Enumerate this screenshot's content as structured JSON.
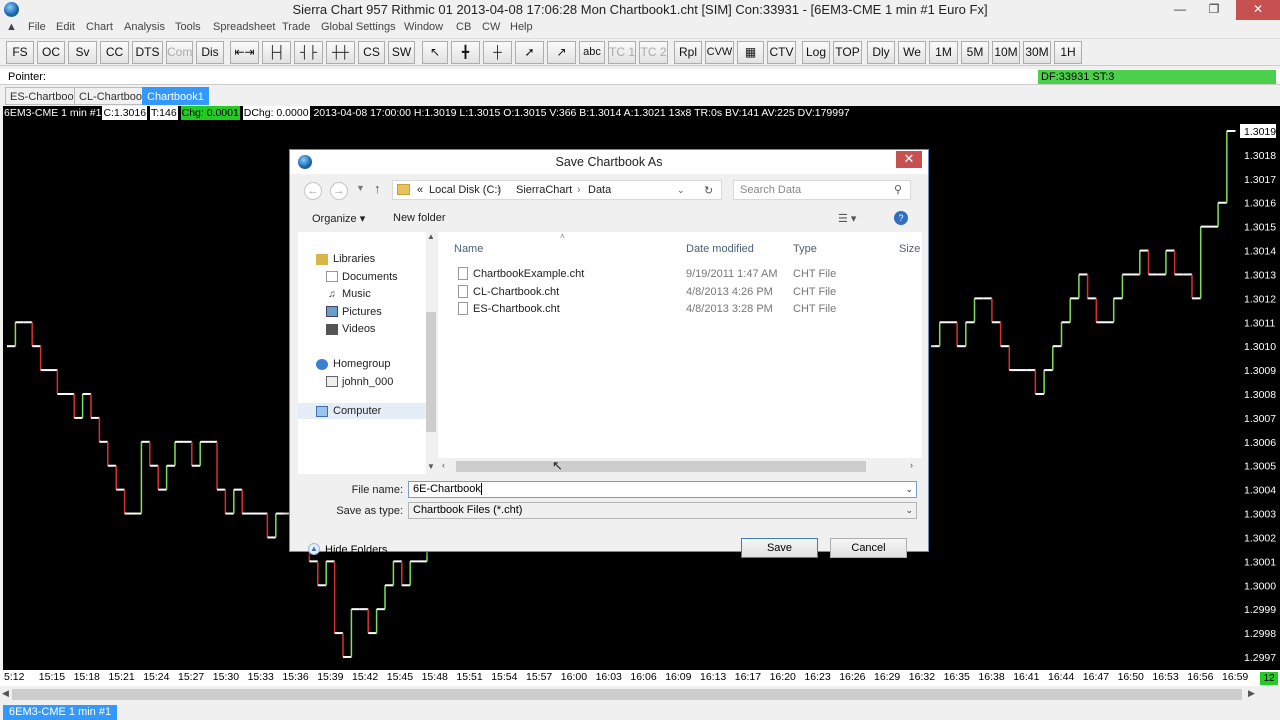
{
  "window": {
    "title": "Sierra Chart 957 Rithmic 01 2013-04-08  17:06:28 Mon  Chartbook1.cht [SIM] Con:33931 - [6EM3-CME  1 min  #1  Euro Fx]"
  },
  "menu": [
    "File",
    "Edit",
    "Chart",
    "Analysis",
    "Tools",
    "Spreadsheet",
    "Trade",
    "Global Settings",
    "Window",
    "CB",
    "CW",
    "Help"
  ],
  "toolbar": {
    "buttons": [
      "FS",
      "OC",
      "Sv",
      "CC",
      "DTS",
      "Com",
      "Dis",
      "",
      "",
      "",
      "",
      "CS",
      "SW",
      "",
      "",
      "",
      "",
      "",
      "abc",
      "TC 1",
      "TC 2",
      "Rpl",
      "CVW",
      "",
      "CTV",
      "Log",
      "TOP",
      "Dly",
      "We",
      "1M",
      "5M",
      "10M",
      "30M",
      "1H"
    ],
    "tool_icons": [
      "bar-spacing-icon",
      "bar-spacing-2-icon",
      "bar-spacing-3-icon",
      "bar-spacing-4-icon",
      "pointer-icon",
      "crosshair-icon",
      "crosshair-2-icon",
      "line-icon",
      "ray-icon",
      "grid-icon"
    ]
  },
  "pointer_bar": {
    "label": "Pointer:",
    "status": "DF:33931  ST:3"
  },
  "chartbook_tabs": [
    "ES-Chartbook",
    "CL-Chartbook",
    "Chartbook1"
  ],
  "chart_info": {
    "symbol": "6EM3-CME  1 min   #1",
    "close": "C:1.3016",
    "ticks": "T:146",
    "chg": "Chg: 0.0001",
    "dchg": "DChg: 0.0000",
    "bar": "2013-04-08 17:00:00 H:1.3019 L:1.3015 O:1.3015 V:366 B:1.3014 A:1.3021 13x8 TR:0s BV:141 AV:225 DV:179997"
  },
  "chart_data": {
    "type": "line",
    "price_labels": [
      "1.3019",
      "1.3018",
      "1.3017",
      "1.3016",
      "1.3015",
      "1.3014",
      "1.3013",
      "1.3012",
      "1.3011",
      "1.3010",
      "1.3009",
      "1.3008",
      "1.3007",
      "1.3006",
      "1.3005",
      "1.3004",
      "1.3003",
      "1.3002",
      "1.3001",
      "1.3000",
      "1.2999",
      "1.2998",
      "1.2997"
    ],
    "ylim": [
      1.2997,
      1.3019
    ],
    "time_labels": [
      "5:12",
      "15:15",
      "15:18",
      "15:21",
      "15:24",
      "15:27",
      "15:30",
      "15:33",
      "15:36",
      "15:39",
      "15:42",
      "15:45",
      "15:48",
      "15:51",
      "15:54",
      "15:57",
      "16:00",
      "16:03",
      "16:06",
      "16:09",
      "16:13",
      "16:17",
      "16:20",
      "16:23",
      "16:26",
      "16:29",
      "16:32",
      "16:35",
      "16:38",
      "16:41",
      "16:44",
      "16:47",
      "16:50",
      "16:53",
      "16:56",
      "16:59"
    ],
    "series": [
      {
        "up_color": "#7ee05a",
        "down_color": "#d83030",
        "segment_1": [
          1.301,
          1.3011,
          1.3011,
          1.301,
          1.3009,
          1.3009,
          1.3008,
          1.3008,
          1.3007,
          1.3008,
          1.3007,
          1.3006,
          1.3005,
          1.3004,
          1.3003,
          1.3003,
          1.3006,
          1.3005,
          1.3004,
          1.3005,
          1.3006,
          1.3006,
          1.3005,
          1.3006,
          1.3006,
          1.3004,
          1.3003,
          1.3004,
          1.3003,
          1.3003,
          1.3003,
          1.3002,
          1.3003,
          1.3003,
          1.3002,
          1.3002,
          1.3001,
          1.3,
          1.3001,
          1.2998,
          1.2997,
          1.2999,
          1.2999,
          1.2998,
          1.2999,
          1.3,
          1.3001,
          1.3,
          1.3001,
          1.3001,
          1.3002
        ],
        "segment_2": [
          1.301,
          1.3011,
          1.3011,
          1.301,
          1.3011,
          1.3012,
          1.3012,
          1.3011,
          1.301,
          1.3009,
          1.3009,
          1.3009,
          1.3008,
          1.3009,
          1.301,
          1.3011,
          1.3012,
          1.3013,
          1.3012,
          1.3011,
          1.3011,
          1.3012,
          1.3013,
          1.3013,
          1.3014,
          1.3013,
          1.3013,
          1.3014,
          1.3013,
          1.3013,
          1.3012,
          1.3015,
          1.3015,
          1.3016,
          1.3019
        ]
      }
    ]
  },
  "status_bar": {
    "tab": "6EM3-CME  1 min  #1",
    "badge": "12"
  },
  "dialog": {
    "title": "Save Chartbook As",
    "address": {
      "prefix": "«",
      "crumbs": [
        "Local Disk (C:)",
        "SierraChart",
        "Data"
      ]
    },
    "search_placeholder": "Search Data",
    "commands": {
      "organize": "Organize ▾",
      "new_folder": "New folder"
    },
    "nav": {
      "libraries": "Libraries",
      "documents": "Documents",
      "music": "Music",
      "pictures": "Pictures",
      "videos": "Videos",
      "homegroup": "Homegroup",
      "user": "johnh_000",
      "computer": "Computer"
    },
    "columns": {
      "name": "Name",
      "date": "Date modified",
      "type": "Type",
      "size": "Size"
    },
    "files": [
      {
        "name": "ChartbookExample.cht",
        "date": "9/19/2011 1:47 AM",
        "type": "CHT File"
      },
      {
        "name": "CL-Chartbook.cht",
        "date": "4/8/2013 4:26 PM",
        "type": "CHT File"
      },
      {
        "name": "ES-Chartbook.cht",
        "date": "4/8/2013 3:28 PM",
        "type": "CHT File"
      }
    ],
    "file_name_label": "File name:",
    "file_name_value": "6E-Chartbook",
    "save_as_type_label": "Save as type:",
    "save_as_type_value": "Chartbook Files (*.cht)",
    "hide_folders": "Hide Folders",
    "save": "Save",
    "cancel": "Cancel"
  }
}
